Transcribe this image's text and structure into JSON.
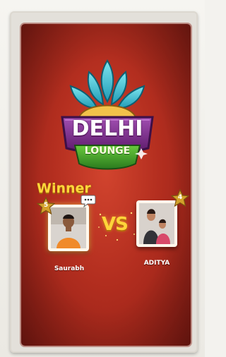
{
  "game": {
    "logo": {
      "line1": "DELHI",
      "line2": "LOUNGE",
      "colors": {
        "petals": "#3ec6d8",
        "banner": "#7a2a8a",
        "ribbon": "#3a9a2a"
      }
    },
    "winner_label": "Winner",
    "vs_label": "VS",
    "players": [
      {
        "name": "Saurabh",
        "level": "5",
        "is_winner": true,
        "avatar": "photo-boy"
      },
      {
        "name": "ADITYA",
        "level": "4",
        "is_winner": false,
        "avatar": "photo-two-kids"
      }
    ],
    "icons": {
      "chat": "chat-bubble-icon",
      "star": "star-level-icon"
    },
    "colors": {
      "background": "#b32e1f",
      "accent": "#ffd43a"
    }
  }
}
